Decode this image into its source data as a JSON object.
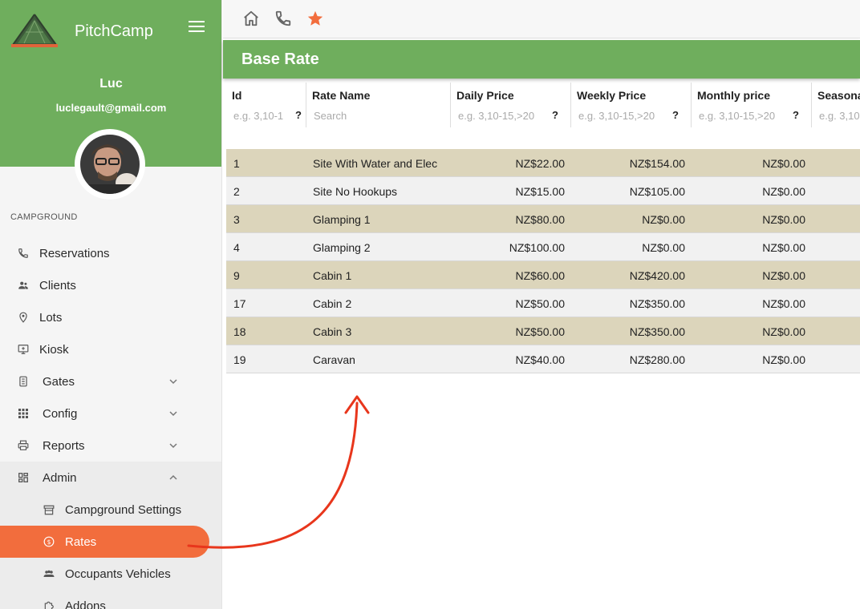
{
  "app": {
    "brand": "PitchCamp"
  },
  "user": {
    "name": "Luc",
    "email": "luclegault@gmail.com"
  },
  "sidebar": {
    "section_label": "CAMPGROUND",
    "items": [
      {
        "label": "Reservations",
        "icon": "phone-icon"
      },
      {
        "label": "Clients",
        "icon": "people-icon"
      },
      {
        "label": "Lots",
        "icon": "map-pin-icon"
      },
      {
        "label": "Kiosk",
        "icon": "kiosk-icon"
      },
      {
        "label": "Gates",
        "icon": "gate-icon"
      },
      {
        "label": "Config",
        "icon": "grid-icon"
      },
      {
        "label": "Reports",
        "icon": "printer-icon"
      },
      {
        "label": "Admin",
        "icon": "dashboard-icon"
      }
    ],
    "admin_sub": [
      {
        "label": "Campground Settings",
        "icon": "store-icon"
      },
      {
        "label": "Rates",
        "icon": "dollar-icon"
      },
      {
        "label": "Occupants Vehicles",
        "icon": "group-icon"
      },
      {
        "label": "Addons",
        "icon": "puzzle-icon"
      }
    ]
  },
  "page": {
    "title": "Base Rate"
  },
  "table": {
    "columns": [
      {
        "title": "Id",
        "filter": "e.g. 3,10-1",
        "help": "?"
      },
      {
        "title": "Rate Name",
        "filter": "Search",
        "help": ""
      },
      {
        "title": "Daily Price",
        "filter": "e.g. 3,10-15,>20",
        "help": "?"
      },
      {
        "title": "Weekly Price",
        "filter": "e.g. 3,10-15,>20",
        "help": "?"
      },
      {
        "title": "Monthly price",
        "filter": "e.g. 3,10-15,>20",
        "help": "?"
      },
      {
        "title": "Seasona",
        "filter": "e.g. 3,10",
        "help": ""
      }
    ],
    "rows": [
      {
        "id": "1",
        "name": "Site With Water and Elec",
        "daily": "NZ$22.00",
        "weekly": "NZ$154.00",
        "monthly": "NZ$0.00"
      },
      {
        "id": "2",
        "name": "Site No Hookups",
        "daily": "NZ$15.00",
        "weekly": "NZ$105.00",
        "monthly": "NZ$0.00"
      },
      {
        "id": "3",
        "name": "Glamping 1",
        "daily": "NZ$80.00",
        "weekly": "NZ$0.00",
        "monthly": "NZ$0.00"
      },
      {
        "id": "4",
        "name": "Glamping 2",
        "daily": "NZ$100.00",
        "weekly": "NZ$0.00",
        "monthly": "NZ$0.00"
      },
      {
        "id": "9",
        "name": "Cabin 1",
        "daily": "NZ$60.00",
        "weekly": "NZ$420.00",
        "monthly": "NZ$0.00"
      },
      {
        "id": "17",
        "name": "Cabin 2",
        "daily": "NZ$50.00",
        "weekly": "NZ$350.00",
        "monthly": "NZ$0.00"
      },
      {
        "id": "18",
        "name": "Cabin 3",
        "daily": "NZ$50.00",
        "weekly": "NZ$350.00",
        "monthly": "NZ$0.00"
      },
      {
        "id": "19",
        "name": "Caravan",
        "daily": "NZ$40.00",
        "weekly": "NZ$280.00",
        "monthly": "NZ$0.00"
      }
    ]
  },
  "colors": {
    "brand_green": "#6fae5d",
    "accent_orange": "#f26d3d",
    "row_highlight": "#dcd5bb"
  }
}
